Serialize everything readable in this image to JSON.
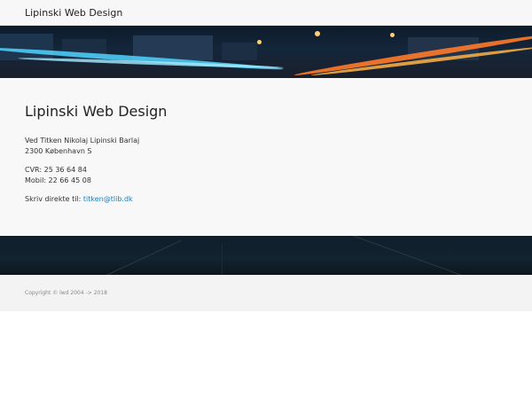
{
  "navbar": {
    "brand": "Lipinski Web Design"
  },
  "main": {
    "title": "Lipinski Web Design",
    "address_line1": "Ved Titken Nikolaj Lipinski Barlaj",
    "address_line2": "2300 København S",
    "cvr": "CVR: 25 36 64 84",
    "mobile": "Mobil: 22 66 45 08",
    "email_prefix": "Skriv direkte til:",
    "email": "titken@tlib.dk"
  },
  "footer": {
    "copyright": "Copyright © lwd 2004 -> 2018"
  }
}
